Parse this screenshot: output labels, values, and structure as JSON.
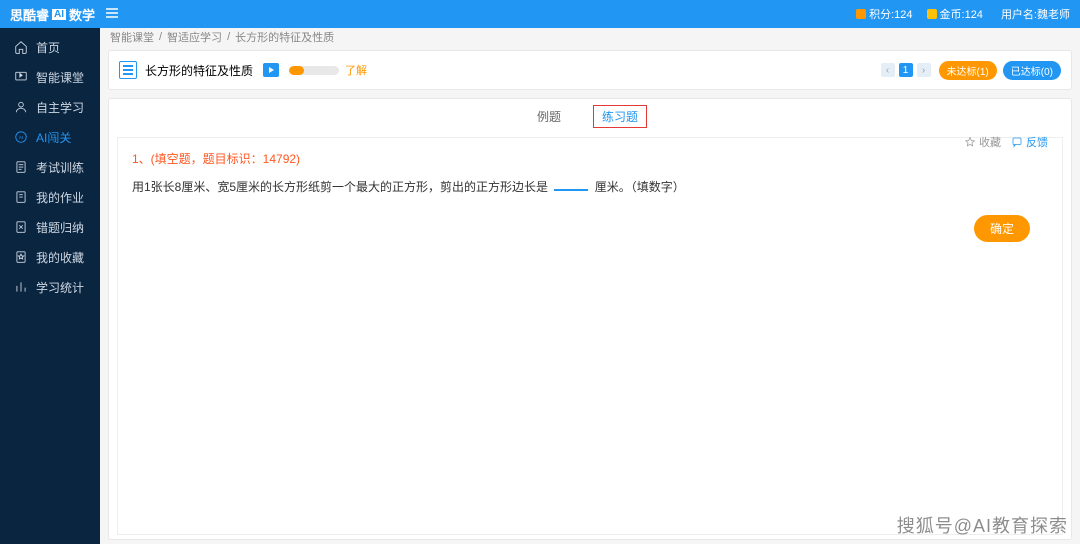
{
  "topbar": {
    "brand_prefix": "思酷睿",
    "brand_mark": "AI",
    "brand_suffix": "数学",
    "points_label": "积分:124",
    "coins_label": "金币:124",
    "user_label": "用户名:魏老师"
  },
  "sidebar": {
    "items": [
      {
        "label": "首页"
      },
      {
        "label": "智能课堂"
      },
      {
        "label": "自主学习"
      },
      {
        "label": "AI闯关"
      },
      {
        "label": "考试训练"
      },
      {
        "label": "我的作业"
      },
      {
        "label": "错题归纳"
      },
      {
        "label": "我的收藏"
      },
      {
        "label": "学习统计"
      }
    ],
    "active_index": 3
  },
  "breadcrumb": {
    "a": "智能课堂",
    "b": "智适应学习",
    "c": "长方形的特征及性质",
    "sep": "/"
  },
  "topic": {
    "title": "长方形的特征及性质",
    "progress_label": "了解",
    "page_number": "1",
    "not_reached": "未达标(1)",
    "reached": "已达标(0)"
  },
  "tabs": {
    "example": "例题",
    "exercise": "练习题"
  },
  "question": {
    "header": "1、(填空题，题目标识：14792)",
    "body_a": "用1张长8厘米、宽5厘米的长方形纸剪一个最大的正方形，剪出的正方形边长是",
    "body_b": "厘米。（填数字）",
    "favorite": "收藏",
    "feedback": "反馈",
    "confirm": "确定"
  },
  "watermark": "搜狐号@AI教育探索"
}
